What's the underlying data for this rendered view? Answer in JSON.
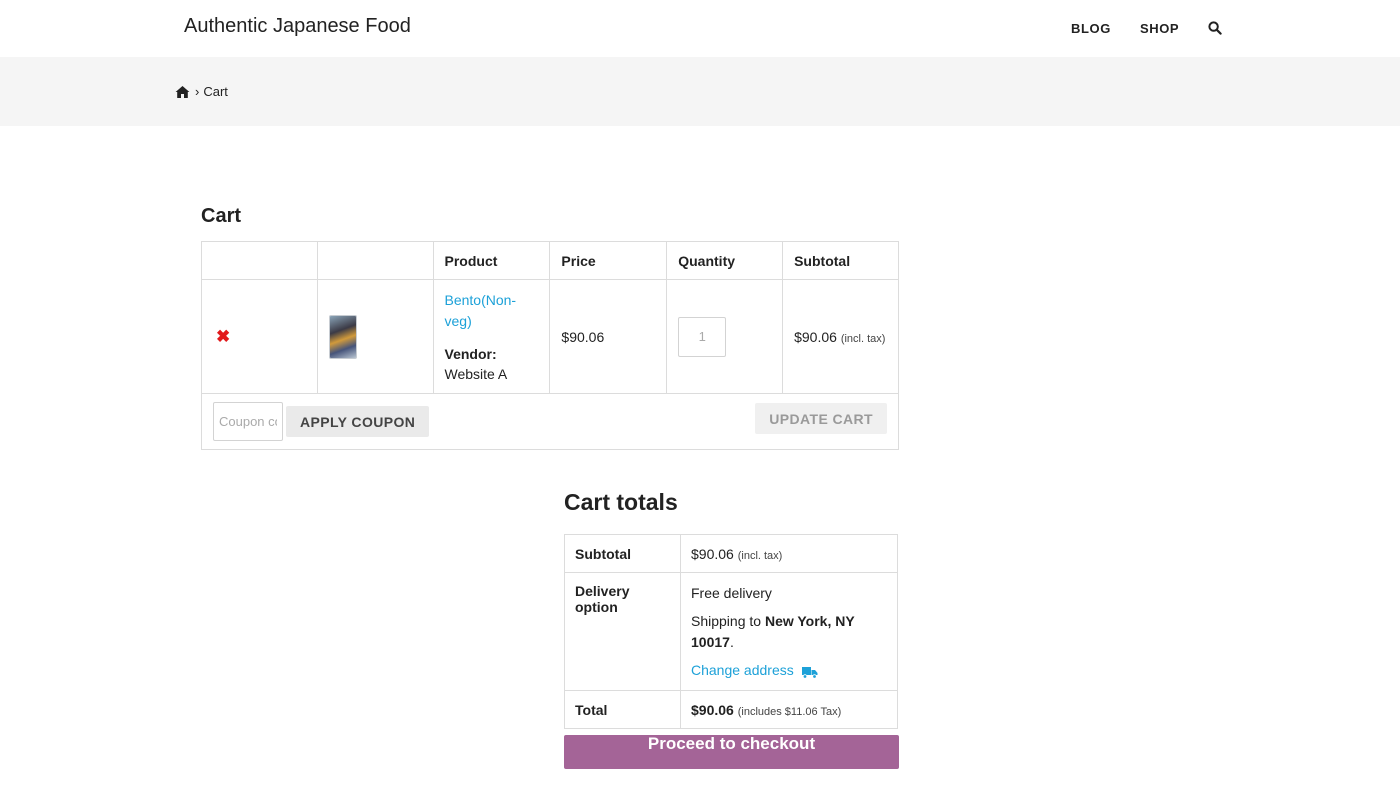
{
  "header": {
    "site_title": "Authentic Japanese Food",
    "nav": {
      "blog": "BLOG",
      "shop": "SHOP"
    },
    "search_icon": "search-icon"
  },
  "breadcrumb": {
    "home_icon": "home-icon",
    "separator": "›",
    "current": "Cart"
  },
  "cart": {
    "heading": "Cart",
    "columns": {
      "remove": "",
      "thumbnail": "",
      "product": "Product",
      "price": "Price",
      "quantity": "Quantity",
      "subtotal": "Subtotal"
    },
    "items": [
      {
        "remove_symbol": "✖",
        "product_name": "Bento(Non-veg)",
        "vendor_label": "Vendor:",
        "vendor_name": "Website A",
        "price": "$90.06",
        "quantity": "1",
        "subtotal": "$90.06",
        "subtotal_note": "(incl. tax)"
      }
    ],
    "coupon": {
      "placeholder": "Coupon code",
      "apply_label": "APPLY COUPON"
    },
    "update_label": "UPDATE CART"
  },
  "totals": {
    "heading": "Cart totals",
    "subtotal_label": "Subtotal",
    "subtotal_value": "$90.06",
    "subtotal_note": "(incl. tax)",
    "delivery_label": "Delivery option",
    "delivery_value": "Free delivery",
    "shipping_prefix": "Shipping to",
    "shipping_location": "New York, NY 10017",
    "shipping_suffix": ".",
    "change_address": "Change address",
    "total_label": "Total",
    "total_value": "$90.06",
    "total_note": "(includes $11.06 Tax)",
    "checkout_label": "Proceed to checkout"
  },
  "colors": {
    "link": "#1da1d8",
    "remove": "#e2191b",
    "checkout": "#a46497",
    "breadcrumb_bg": "#f5f5f5"
  }
}
